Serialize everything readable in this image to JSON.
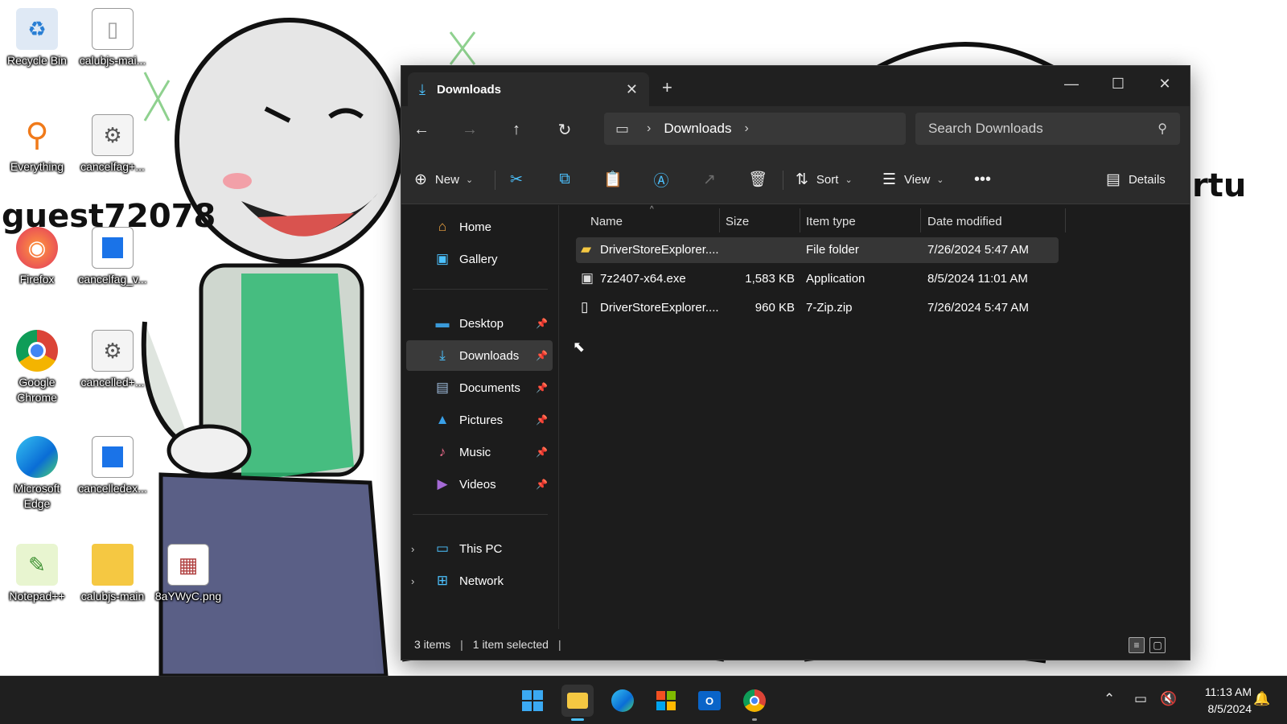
{
  "desktop": {
    "wallpaper_text": "guest72078",
    "wallpaper_text_right": "rtu",
    "icons": [
      {
        "label": "Recycle Bin",
        "icon": "recycle-bin-icon"
      },
      {
        "label": "calubjs-mai...",
        "icon": "file-icon"
      },
      {
        "label": "Everything",
        "icon": "everything-search-icon"
      },
      {
        "label": "cancelfag+...",
        "icon": "settings-file-icon"
      },
      {
        "label": "Firefox",
        "icon": "firefox-icon"
      },
      {
        "label": "cancelfag_v...",
        "icon": "app-icon"
      },
      {
        "label": "Google Chrome",
        "icon": "chrome-icon"
      },
      {
        "label": "cancelled+...",
        "icon": "settings-file-icon"
      },
      {
        "label": "Microsoft Edge",
        "icon": "edge-icon"
      },
      {
        "label": "cancelledex...",
        "icon": "app-icon"
      },
      {
        "label": "Notepad++",
        "icon": "notepad-plus-plus-icon"
      },
      {
        "label": "calubjs-main",
        "icon": "folder-icon"
      },
      {
        "label": "8aYWyC.png",
        "icon": "image-file-icon"
      }
    ]
  },
  "explorer": {
    "tab_title": "Downloads",
    "address": {
      "root_icon": "this-pc-icon",
      "segment": "Downloads"
    },
    "search_placeholder": "Search Downloads",
    "toolbar": {
      "new_label": "New",
      "sort_label": "Sort",
      "view_label": "View",
      "details_label": "Details"
    },
    "sidebar": [
      {
        "label": "Home",
        "icon": "home-icon",
        "pinned": false
      },
      {
        "label": "Gallery",
        "icon": "gallery-icon",
        "pinned": false
      },
      {
        "label": "Desktop",
        "icon": "desktop-icon",
        "pinned": true
      },
      {
        "label": "Downloads",
        "icon": "downloads-icon",
        "pinned": true,
        "selected": true
      },
      {
        "label": "Documents",
        "icon": "documents-icon",
        "pinned": true
      },
      {
        "label": "Pictures",
        "icon": "pictures-icon",
        "pinned": true
      },
      {
        "label": "Music",
        "icon": "music-icon",
        "pinned": true
      },
      {
        "label": "Videos",
        "icon": "videos-icon",
        "pinned": true
      },
      {
        "label": "This PC",
        "icon": "this-pc-icon",
        "expandable": true
      },
      {
        "label": "Network",
        "icon": "network-icon",
        "expandable": true
      }
    ],
    "columns": [
      "Name",
      "Size",
      "Item type",
      "Date modified"
    ],
    "files": [
      {
        "name": "DriverStoreExplorer....",
        "size": "",
        "type": "File folder",
        "modified": "7/26/2024 5:47 AM",
        "icon": "folder-icon",
        "selected": true
      },
      {
        "name": "7z2407-x64.exe",
        "size": "1,583 KB",
        "type": "Application",
        "modified": "8/5/2024 11:01 AM",
        "icon": "exe-icon",
        "selected": false
      },
      {
        "name": "DriverStoreExplorer....",
        "size": "960 KB",
        "type": "7-Zip.zip",
        "modified": "7/26/2024 5:47 AM",
        "icon": "zip-file-icon",
        "selected": false
      }
    ],
    "status": {
      "items": "3 items",
      "selection": "1 item selected"
    }
  },
  "taskbar": {
    "apps": [
      "start-icon",
      "file-explorer-icon",
      "edge-icon",
      "microsoft-store-icon",
      "outlook-new-icon",
      "chrome-icon"
    ],
    "time": "11:13 AM",
    "date": "8/5/2024"
  },
  "colors": {
    "accent": "#4cc2ff",
    "window_bg": "#1c1c1c",
    "toolbar_bg": "#2b2b2b",
    "taskbar_bg": "#1f1f1f"
  }
}
